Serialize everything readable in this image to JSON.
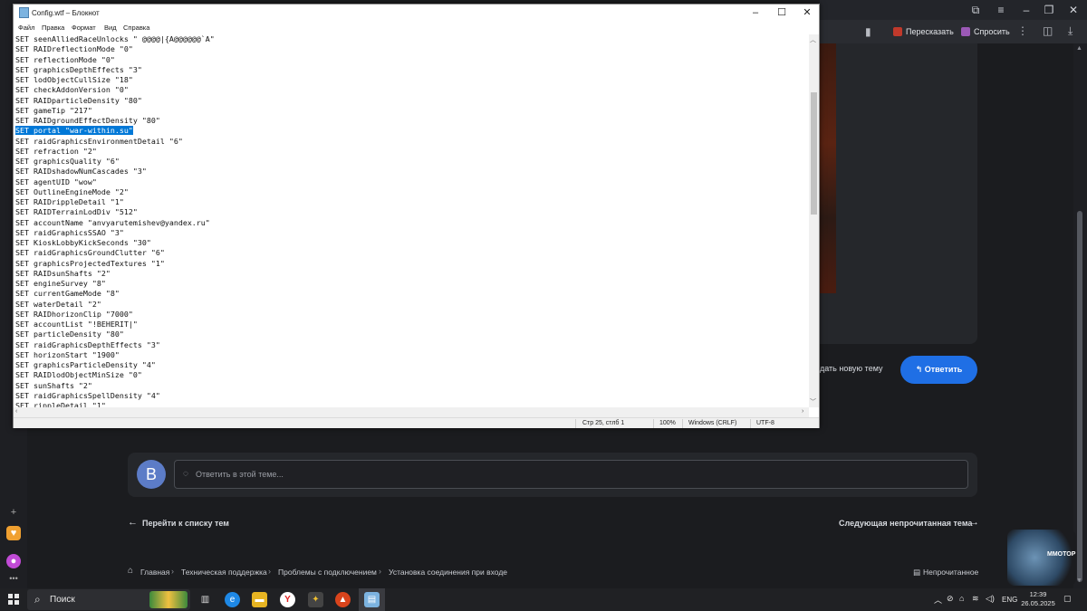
{
  "browser": {
    "actions": {
      "retell": "Пересказать",
      "ask": "Спросить"
    }
  },
  "forum": {
    "new_topic": "дать новую тему",
    "reply_button": "Ответить",
    "avatar_letter": "B",
    "reply_placeholder": "Ответить в этой теме...",
    "back_to_list": "Перейти к списку тем",
    "next_unread": "Следующая непрочитанная тема",
    "breadcrumbs": [
      "Главная",
      "Техническая поддержка",
      "Проблемы с подключением",
      "Установка соединения при входе"
    ],
    "unread": "Непрочитанное",
    "logo_text": "MMOTOP"
  },
  "notepad": {
    "title": "Config.wtf – Блокнот",
    "menu": [
      "Файл",
      "Правка",
      "Формат",
      "Вид",
      "Справка"
    ],
    "selected_line": 9,
    "lines": [
      "SET seenAlliedRaceUnlocks \" @@@@|{A@@@@@@`A\"",
      "SET RAIDreflectionMode \"0\"",
      "SET reflectionMode \"0\"",
      "SET graphicsDepthEffects \"3\"",
      "SET lodObjectCullSize \"18\"",
      "SET checkAddonVersion \"0\"",
      "SET RAIDparticleDensity \"80\"",
      "SET gameTip \"217\"",
      "SET RAIDgroundEffectDensity \"80\"",
      "SET portal \"war-within.su\"",
      "SET raidGraphicsEnvironmentDetail \"6\"",
      "SET refraction \"2\"",
      "SET graphicsQuality \"6\"",
      "SET RAIDshadowNumCascades \"3\"",
      "SET agentUID \"wow\"",
      "SET OutlineEngineMode \"2\"",
      "SET RAIDrippleDetail \"1\"",
      "SET RAIDTerrainLodDiv \"512\"",
      "SET accountName \"anvyarutemishev@yandex.ru\"",
      "SET raidGraphicsSSAO \"3\"",
      "SET KioskLobbyKickSeconds \"30\"",
      "SET raidGraphicsGroundClutter \"6\"",
      "SET graphicsProjectedTextures \"1\"",
      "SET RAIDsunShafts \"2\"",
      "SET engineSurvey \"8\"",
      "SET currentGameMode \"8\"",
      "SET waterDetail \"2\"",
      "SET RAIDhorizonClip \"7000\"",
      "SET accountList \"!BEHERIT|\"",
      "SET particleDensity \"80\"",
      "SET raidGraphicsDepthEffects \"3\"",
      "SET horizonStart \"1900\"",
      "SET graphicsParticleDensity \"4\"",
      "SET RAIDlodObjectMinSize \"0\"",
      "SET sunShafts \"2\"",
      "SET raidGraphicsSpellDensity \"4\"",
      "SET rippleDetail \"1\""
    ],
    "status": {
      "position": "Стр 25, стлб 1",
      "zoom": "100%",
      "eol": "Windows (CRLF)",
      "encoding": "UTF-8"
    }
  },
  "taskbar": {
    "search": "Поиск",
    "lang": "ENG",
    "time": "12:39",
    "date": "26.05.2025"
  }
}
